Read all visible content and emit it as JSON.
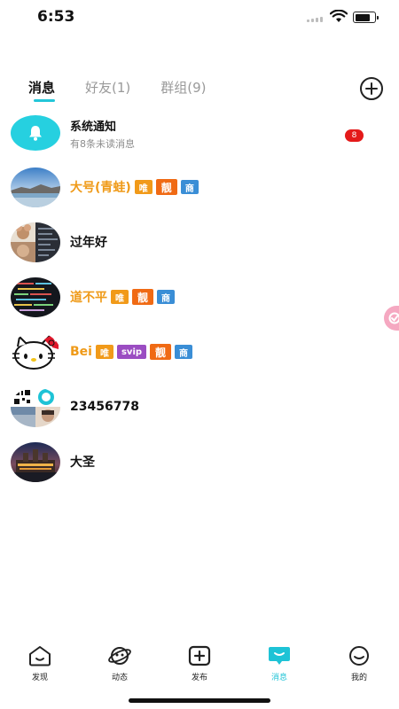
{
  "status_bar": {
    "time": "6:53"
  },
  "tabs": [
    {
      "label": "消息",
      "active": true
    },
    {
      "label": "好友(1)",
      "active": false
    },
    {
      "label": "群组(9)",
      "active": false
    }
  ],
  "system_notice": {
    "title": "系统通知",
    "subtitle": "有8条未读消息",
    "unread_count": "8"
  },
  "conversations": [
    {
      "name": "大号(青蛙)",
      "tags": [
        "唯",
        "靓",
        "商"
      ]
    },
    {
      "name": "过年好",
      "tags": []
    },
    {
      "name": "道不平",
      "tags": [
        "唯",
        "靓",
        "商"
      ]
    },
    {
      "name": "Bei",
      "tags": [
        "唯",
        "svip",
        "靓",
        "商"
      ]
    },
    {
      "name": "23456778",
      "tags": []
    },
    {
      "name": "大圣",
      "tags": []
    }
  ],
  "bottom_nav": [
    {
      "label": "发现",
      "icon": "home-icon",
      "active": false
    },
    {
      "label": "动态",
      "icon": "planet-icon",
      "active": false
    },
    {
      "label": "发布",
      "icon": "publish-icon",
      "active": false
    },
    {
      "label": "消息",
      "icon": "message-icon",
      "active": true
    },
    {
      "label": "我的",
      "icon": "profile-icon",
      "active": false
    }
  ],
  "colors": {
    "accent": "#1ec3d6",
    "vip_name": "#ef9a18",
    "tag_wei": "#f19a19",
    "tag_liang": "#f06a14",
    "tag_shang": "#3a8ed6",
    "tag_svip": "#9b4dc2",
    "badge": "#e41a1a"
  }
}
